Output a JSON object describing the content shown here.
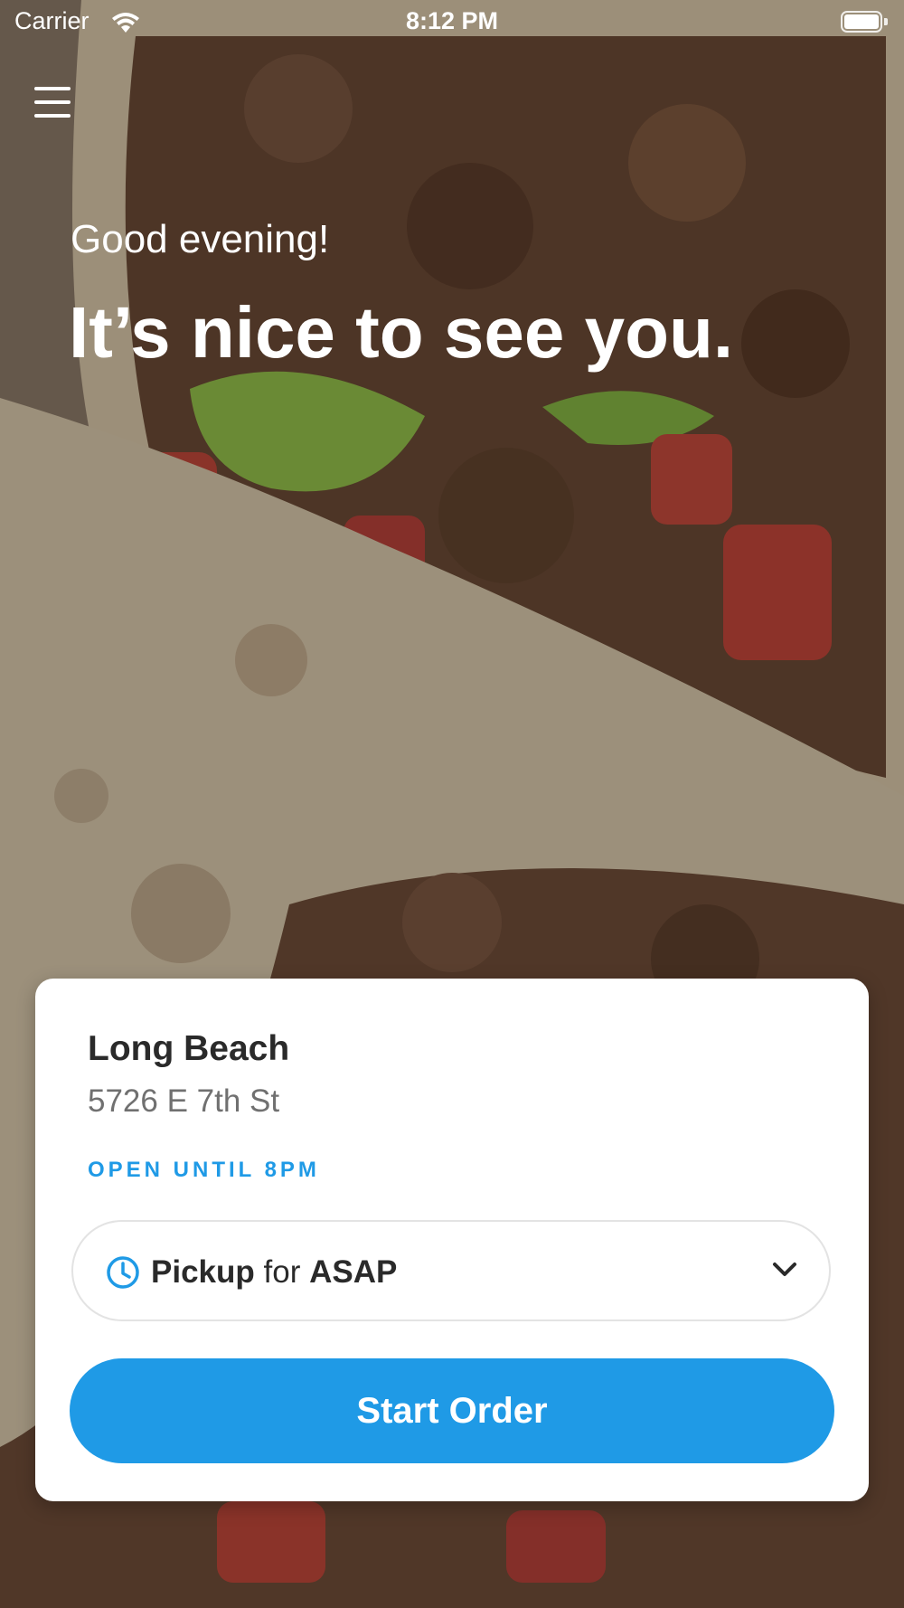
{
  "status_bar": {
    "carrier": "Carrier",
    "time": "8:12 PM"
  },
  "greeting": {
    "salutation": "Good evening!",
    "headline": "It’s nice to see you."
  },
  "location": {
    "name": "Long Beach",
    "address": "5726 E 7th St",
    "hours": "OPEN UNTIL 8PM"
  },
  "order_type": {
    "mode": "Pickup",
    "connector": "for",
    "time": "ASAP"
  },
  "start_button": {
    "label": "Start Order"
  },
  "colors": {
    "accent": "#1f9ae6",
    "card_bg": "#ffffff"
  },
  "icons": [
    "wifi-icon",
    "battery-icon",
    "hamburger-menu-icon",
    "clock-icon",
    "chevron-down-icon"
  ]
}
